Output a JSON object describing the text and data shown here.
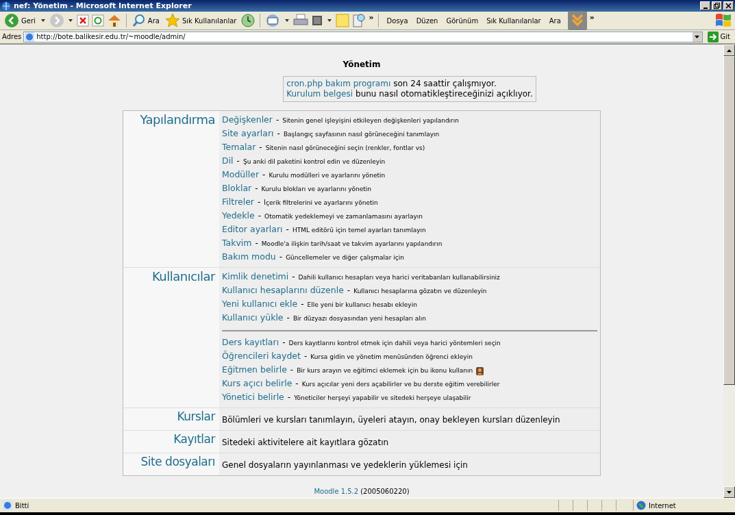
{
  "window": {
    "title": "nef: Yönetim - Microsoft Internet Explorer"
  },
  "dash": "-",
  "toolbar": {
    "back_label": "Geri",
    "search_label": "Ara",
    "favorites_label": "Sık Kullanılanlar",
    "overflow": "»",
    "menu": [
      "Dosya",
      "Düzen",
      "Görünüm",
      "Sık Kullanılanlar",
      "Ara"
    ],
    "menu_overflow": "»"
  },
  "address_bar": {
    "label": "Adres",
    "url": "http://bote.balikesir.edu.tr/~moodle/admin/",
    "go_label": "Git"
  },
  "page": {
    "heading": "Yönetim",
    "notice": [
      {
        "link": "cron.php bakım programı",
        "text": "son 24 saattir çalışmıyor."
      },
      {
        "link": "Kurulum belgesi",
        "text": "bunu nasıl otomatikleştireceğinizi açıklıyor."
      }
    ],
    "sections": [
      {
        "title": "Yapılandırma",
        "kind": "links",
        "groups": [
          {
            "items": [
              {
                "link": "Değişkenler",
                "desc": "Sitenin genel işleyişini etkileyen değişkenleri yapılandırın",
                "icon": false
              },
              {
                "link": "Site ayarları",
                "desc": "Başlangıç sayfasının nasıl görüneceğini tanımlayın",
                "icon": false
              },
              {
                "link": "Temalar",
                "desc": "Sitenin nasıl görüneceğini seçin (renkler, fontlar vs)",
                "icon": false
              },
              {
                "link": "Dil",
                "desc": "Şu anki dil paketini kontrol edin ve düzenleyin",
                "icon": false
              },
              {
                "link": "Modüller",
                "desc": "Kurulu modülleri ve ayarlarını yönetin",
                "icon": false
              },
              {
                "link": "Bloklar",
                "desc": "Kurulu blokları ve ayarlarını yönetin",
                "icon": false
              },
              {
                "link": "Filtreler",
                "desc": "İçerik filtrelerini ve ayarlarını yönetin",
                "icon": false
              },
              {
                "link": "Yedekle",
                "desc": "Otomatik yedeklemeyi ve zamanlamasını ayarlayın",
                "icon": false
              },
              {
                "link": "Editor ayarları",
                "desc": "HTML editörü için temel ayarları tanımlayın",
                "icon": false
              },
              {
                "link": "Takvim",
                "desc": "Moodle'a ilişkin tarih/saat ve takvim ayarlarını yapılandırın",
                "icon": false
              },
              {
                "link": "Bakım modu",
                "desc": "Güncellemeler ve diğer çalışmalar için",
                "icon": false
              }
            ]
          }
        ]
      },
      {
        "title": "Kullanıcılar",
        "kind": "links",
        "groups": [
          {
            "items": [
              {
                "link": "Kimlik denetimi",
                "desc": "Dahili kullanıcı hesapları veya harici veritabanları kullanabilirsiniz",
                "icon": false
              },
              {
                "link": "Kullanıcı hesaplarını düzenle",
                "desc": "Kullanıcı hesaplarına gözatın ve düzenleyin",
                "icon": false
              },
              {
                "link": "Yeni kullanıcı ekle",
                "desc": "Elle yeni bir kullanıcı hesabı ekleyin",
                "icon": false
              },
              {
                "link": "Kullanıcı yükle",
                "desc": "Bir düzyazı dosyasından yeni hesapları alın",
                "icon": false
              }
            ]
          },
          {
            "items": [
              {
                "link": "Ders kayıtları",
                "desc": "Ders kayıtlarını kontrol etmek için dahili veya harici yöntemleri seçin",
                "icon": false
              },
              {
                "link": "Öğrencileri kaydet",
                "desc": "Kursa gidin ve yönetim menüsünden öğrenci ekleyin",
                "icon": false
              },
              {
                "link": "Eğitmen belirle",
                "desc": "Bir kurs arayın ve eğitimci eklemek için bu ikonu kullanın",
                "icon": true
              },
              {
                "link": "Kurs açıcı belirle",
                "desc": "Kurs açıcılar yeni ders açabilirler ve bu derste eğitim verebilirler",
                "icon": false
              },
              {
                "link": "Yönetici belirle",
                "desc": "Yöneticiler herşeyi yapabilir ve sitedeki herşeye ulaşabilir",
                "icon": false
              }
            ]
          }
        ]
      },
      {
        "title": "Kurslar",
        "kind": "text",
        "text": "Bölümleri ve kursları tanımlayın, üyeleri atayın, onay bekleyen kursları düzenleyin"
      },
      {
        "title": "Kayıtlar",
        "kind": "text",
        "text": "Sitedeki aktivitelere ait kayıtlara gözatın"
      },
      {
        "title": "Site dosyaları",
        "kind": "text",
        "text": "Genel dosyaların yayınlanması ve yedeklerin yüklemesi için"
      }
    ],
    "footer": {
      "link": "Moodle 1.5.2",
      "text": "(2005060220)"
    }
  },
  "status_bar": {
    "text": "Bitti",
    "zone": "Internet"
  }
}
